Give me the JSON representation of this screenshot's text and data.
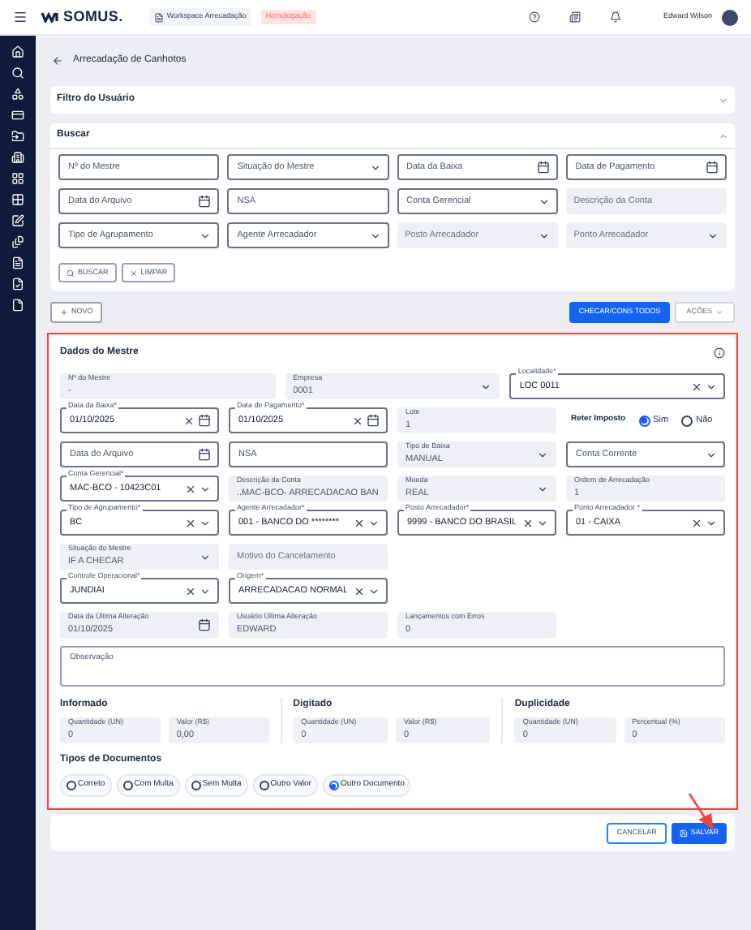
{
  "topbar": {
    "brand": "SOMUS.",
    "workspace": "Workspace Arrecadação",
    "environment": "Homologação",
    "user": "Edward Wilson"
  },
  "page": {
    "title": "Arrecadação de Canhotos"
  },
  "user_filter": {
    "title": "Filtro do Usuário",
    "expanded": false
  },
  "search": {
    "title": "Buscar",
    "expanded": true,
    "fields": [
      {
        "kind": "input",
        "placeholder": "Nº do Mestre",
        "disabled": false
      },
      {
        "kind": "select",
        "placeholder": "Situação do Mestre",
        "disabled": false
      },
      {
        "kind": "date",
        "placeholder": "Data da Baixa",
        "disabled": false
      },
      {
        "kind": "date",
        "placeholder": "Data de Pagamento",
        "disabled": false
      },
      {
        "kind": "date",
        "placeholder": "Data do Arquivo",
        "disabled": false
      },
      {
        "kind": "input",
        "placeholder": "NSA",
        "disabled": false
      },
      {
        "kind": "select",
        "placeholder": "Conta Gerencial",
        "disabled": false
      },
      {
        "kind": "input",
        "placeholder": "Descrição da Conta",
        "disabled": true
      },
      {
        "kind": "select",
        "placeholder": "Tipo de Agrupamento",
        "disabled": false
      },
      {
        "kind": "select",
        "placeholder": "Agente Arrecadador",
        "disabled": false
      },
      {
        "kind": "select",
        "placeholder": "Posto Arrecadador",
        "disabled": true
      },
      {
        "kind": "select",
        "placeholder": "Ponto Arrecadador",
        "disabled": true
      }
    ],
    "buttons": [
      "BUSCAR",
      "LIMPAR"
    ]
  },
  "toolbar": {
    "new": "NOVO",
    "check_all": "CHECAR/CONS TODOS",
    "actions": "AÇÕES"
  },
  "master": {
    "title": "Dados do Mestre",
    "rows": [
      [
        {
          "kind": "input",
          "label": "Nº do Mestre",
          "value": "-",
          "disabled": true
        },
        {
          "kind": "select",
          "label": "Empresa",
          "value": "0001",
          "disabled": true
        },
        {
          "kind": "select",
          "label": "Localidade*",
          "value": "LOC 0011",
          "disabled": false,
          "clearable": true
        }
      ],
      [
        {
          "kind": "date",
          "label": "Data da Baixa*",
          "value": "01/10/2025",
          "disabled": false,
          "clearable": true
        },
        {
          "kind": "date",
          "label": "Data de Pagamento*",
          "value": "01/10/2025",
          "disabled": false,
          "clearable": true
        },
        {
          "kind": "input",
          "label": "Lote",
          "value": "1",
          "disabled": true
        },
        {
          "kind": "radio",
          "label": "Reter Imposto",
          "options": [
            {
              "label": "Sim",
              "selected": true
            },
            {
              "label": "Não",
              "selected": false
            }
          ]
        }
      ],
      [
        {
          "kind": "date",
          "placeholder": "Data do Arquivo",
          "disabled": false
        },
        {
          "kind": "input",
          "placeholder": "NSA",
          "disabled": false
        },
        {
          "kind": "select",
          "label": "Tipo de Baixa",
          "value": "MANUAL",
          "disabled": true
        },
        {
          "kind": "select",
          "placeholder": "Conta Corrente",
          "disabled": false
        }
      ],
      [
        {
          "kind": "select",
          "label": "Conta Gerencial*",
          "value": "MAC-BCO - 10423C01",
          "disabled": false,
          "clearable": true
        },
        {
          "kind": "input",
          "label": "Descrição da Conta",
          "value": "..MAC-BCO- ARRECADACAO BAN",
          "disabled": true
        },
        {
          "kind": "select",
          "label": "Moeda",
          "value": "REAL",
          "disabled": true
        },
        {
          "kind": "input",
          "label": "Ordem de Arrecadação",
          "value": "1",
          "disabled": true
        }
      ],
      [
        {
          "kind": "select",
          "label": "Tipo de Agrupamento*",
          "value": "BC",
          "disabled": false,
          "clearable": true
        },
        {
          "kind": "select",
          "label": "Agente Arrecadador*",
          "value": "001 - BANCO DO ********",
          "disabled": false,
          "clearable": true
        },
        {
          "kind": "select",
          "label": "Posto Arrecadador*",
          "value": "9999 - BANCO DO BRASIL",
          "disabled": false,
          "clearable": true
        },
        {
          "kind": "select",
          "label": "Ponto Arrecadador *",
          "value": "01 - CAIXA",
          "disabled": false,
          "clearable": true
        }
      ],
      [
        {
          "kind": "select",
          "label": "Situação do Mestre",
          "value": "IF A CHECAR",
          "disabled": true
        },
        {
          "kind": "input",
          "placeholder": "Motivo do Cancelamento",
          "disabled": true
        }
      ],
      [
        {
          "kind": "select",
          "label": "Controle Operacional*",
          "value": "JUNDIAI",
          "disabled": false,
          "clearable": true
        },
        {
          "kind": "select",
          "label": "Origem*",
          "value": "ARRECADACAO NORMAL",
          "disabled": false,
          "clearable": true
        }
      ],
      [
        {
          "kind": "date",
          "label": "Data da Última Alteração",
          "value": "01/10/2025",
          "disabled": true
        },
        {
          "kind": "input",
          "label": "Usuário Última Alteração",
          "value": "EDWARD",
          "disabled": true
        },
        {
          "kind": "input",
          "label": "Lançamentos com Erros",
          "value": "0",
          "disabled": true
        }
      ],
      [
        {
          "kind": "textarea",
          "placeholder": "Observação"
        }
      ]
    ]
  },
  "summary": [
    {
      "title": "Informado",
      "fields": [
        {
          "kind": "input",
          "label": "Quantidade (UN)",
          "value": "0",
          "disabled": true
        },
        {
          "kind": "input",
          "label": "Valor (R$)",
          "value": "0,00",
          "disabled": true
        }
      ]
    },
    {
      "title": "Digitado",
      "fields": [
        {
          "kind": "input",
          "label": "Quantidade (UN)",
          "value": "0",
          "disabled": true
        },
        {
          "kind": "input",
          "label": "Valor (R$)",
          "value": "0",
          "disabled": true
        }
      ]
    },
    {
      "title": "Duplicidade",
      "fields": [
        {
          "kind": "input",
          "label": "Quantidade (UN)",
          "value": "0",
          "disabled": true
        },
        {
          "kind": "input",
          "label": "Percentual (%)",
          "value": "0",
          "disabled": true
        }
      ]
    }
  ],
  "document_types": {
    "title": "Tipos de Documentos",
    "options": [
      {
        "label": "Correto",
        "selected": false
      },
      {
        "label": "Com Multa",
        "selected": false
      },
      {
        "label": "Sem Multa",
        "selected": false
      },
      {
        "label": "Outro Valor",
        "selected": false
      },
      {
        "label": "Outro Documento",
        "selected": true
      }
    ]
  },
  "footer": {
    "cancel": "CANCELAR",
    "save": "SALVAR"
  }
}
